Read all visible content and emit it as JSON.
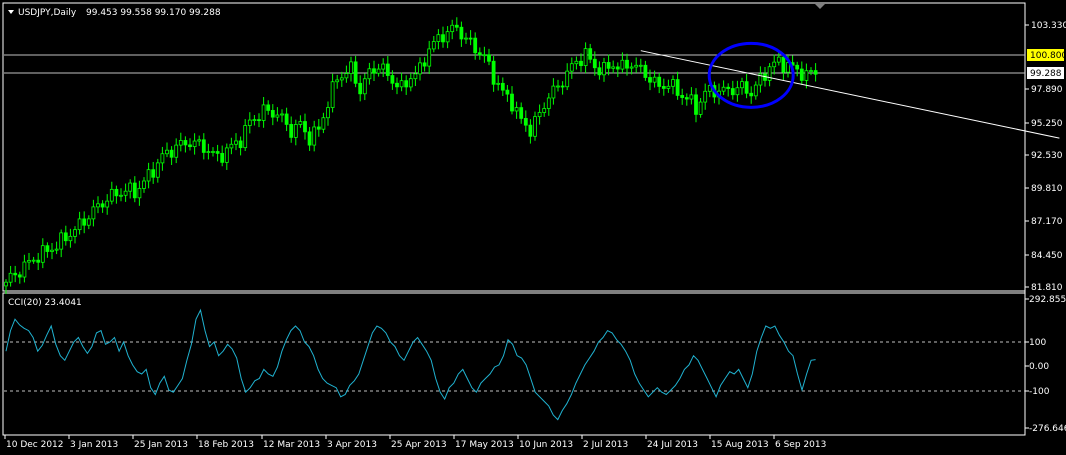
{
  "main_panel": {
    "title": "USDJPY,Daily",
    "ohlc": "99.453 99.558 99.170 99.288",
    "menu_arrow": "triangle-down-icon"
  },
  "indicator_panel": {
    "title": "CCI(20) 23.4041"
  },
  "colors": {
    "background": "#000000",
    "candles": "#00ff00",
    "grid_border": "#ffffff",
    "h_lines": "#c0c0c0",
    "highlight_label": "#ffff00",
    "current_label": "#ffffff",
    "cci_line": "#20b2d0",
    "annotation_ellipse": "#0000ff",
    "trendline": "#ffffff"
  },
  "chart_data": [
    {
      "type": "candlestick",
      "title": "USDJPY,Daily",
      "ylim": [
        81.81,
        104.5
      ],
      "y_ticks": [
        "103.330",
        "100.800",
        "99.288",
        "97.890",
        "95.250",
        "92.530",
        "89.810",
        "87.170",
        "84.450",
        "81.810"
      ],
      "horizontal_lines": [
        100.8,
        99.288
      ],
      "highlighted_price": "100.800",
      "current_price": "99.288",
      "x_ticks": [
        "10 Dec 2012",
        "3 Jan 2013",
        "25 Jan 2013",
        "18 Feb 2013",
        "12 Mar 2013",
        "3 Apr 2013",
        "25 Apr 2013",
        "17 May 2013",
        "10 Jun 2013",
        "2 Jul 2013",
        "24 Jul 2013",
        "15 Aug 2013",
        "6 Sep 2013"
      ],
      "close_path": [
        [
          0,
          82.2
        ],
        [
          6,
          84.1
        ],
        [
          11,
          85.2
        ],
        [
          16,
          86.8
        ],
        [
          19,
          88.0
        ],
        [
          22,
          89.0
        ],
        [
          26,
          89.7
        ],
        [
          28,
          89.5
        ],
        [
          31,
          90.8
        ],
        [
          34,
          92.4
        ],
        [
          37,
          93.2
        ],
        [
          40,
          93.6
        ],
        [
          43,
          93.2
        ],
        [
          46,
          92.3
        ],
        [
          48,
          92.9
        ],
        [
          51,
          93.8
        ],
        [
          53,
          95.2
        ],
        [
          56,
          96.1
        ],
        [
          59,
          95.9
        ],
        [
          62,
          94.5
        ],
        [
          64,
          95.0
        ],
        [
          66,
          93.9
        ],
        [
          68,
          94.6
        ],
        [
          70,
          96.8
        ],
        [
          72,
          98.8
        ],
        [
          75,
          99.5
        ],
        [
          77,
          97.8
        ],
        [
          79,
          99.2
        ],
        [
          81,
          99.8
        ],
        [
          83,
          99.0
        ],
        [
          86,
          97.9
        ],
        [
          88,
          98.9
        ],
        [
          90,
          99.4
        ],
        [
          92,
          101.2
        ],
        [
          95,
          102.3
        ],
        [
          98,
          102.9
        ],
        [
          100,
          101.9
        ],
        [
          102,
          101.2
        ],
        [
          104,
          100.5
        ],
        [
          106,
          98.9
        ],
        [
          108,
          97.6
        ],
        [
          110,
          96.8
        ],
        [
          112,
          95.3
        ],
        [
          114,
          94.6
        ],
        [
          116,
          95.8
        ],
        [
          118,
          97.4
        ],
        [
          120,
          98.0
        ],
        [
          122,
          99.2
        ],
        [
          124,
          100.1
        ],
        [
          126,
          100.7
        ],
        [
          128,
          99.7
        ],
        [
          130,
          99.4
        ],
        [
          132,
          99.9
        ],
        [
          134,
          99.6
        ],
        [
          136,
          100.0
        ],
        [
          138,
          99.4
        ],
        [
          140,
          98.8
        ],
        [
          142,
          98.0
        ],
        [
          144,
          98.4
        ],
        [
          146,
          97.6
        ],
        [
          148,
          97.2
        ],
        [
          150,
          96.3
        ],
        [
          152,
          97.6
        ],
        [
          154,
          97.8
        ],
        [
          156,
          97.7
        ],
        [
          158,
          97.9
        ],
        [
          160,
          98.0
        ],
        [
          162,
          97.6
        ],
        [
          164,
          98.6
        ],
        [
          166,
          99.7
        ],
        [
          168,
          100.1
        ],
        [
          170,
          99.8
        ],
        [
          172,
          99.4
        ],
        [
          174,
          99.0
        ],
        [
          176,
          99.3
        ]
      ],
      "trendline": {
        "from": [
          138,
          101.0
        ],
        "to": [
          229,
          93.9
        ]
      },
      "annotation": {
        "type": "ellipse",
        "center": [
          162,
          99.0
        ]
      }
    },
    {
      "type": "line",
      "title": "CCI(20) 23.4041",
      "ylim": [
        -276.646,
        292.8552
      ],
      "y_ticks": [
        "292.8552",
        "100",
        "0.00",
        "-100",
        "-276.646"
      ],
      "levels": [
        100,
        -100
      ],
      "values": [
        60,
        150,
        200,
        175,
        160,
        150,
        120,
        60,
        85,
        130,
        170,
        90,
        40,
        20,
        60,
        100,
        120,
        80,
        50,
        80,
        140,
        150,
        90,
        100,
        120,
        60,
        100,
        40,
        0,
        -30,
        -40,
        -20,
        -100,
        -130,
        -80,
        -50,
        -110,
        -120,
        -90,
        -60,
        20,
        90,
        200,
        240,
        150,
        80,
        100,
        40,
        60,
        90,
        70,
        30,
        -60,
        -120,
        -100,
        -70,
        -60,
        -20,
        -40,
        -50,
        -10,
        60,
        110,
        150,
        170,
        150,
        100,
        80,
        40,
        -20,
        -60,
        -80,
        -90,
        -100,
        -140,
        -130,
        -90,
        -70,
        -40,
        20,
        80,
        140,
        170,
        160,
        140,
        100,
        80,
        40,
        20,
        60,
        100,
        120,
        90,
        60,
        20,
        -60,
        -120,
        -150,
        -100,
        -80,
        -40,
        -20,
        -60,
        -100,
        -120,
        -80,
        -60,
        -40,
        -10,
        0,
        40,
        110,
        90,
        40,
        30,
        0,
        -60,
        -120,
        -140,
        -160,
        -180,
        -220,
        -240,
        -200,
        -170,
        -130,
        -80,
        -40,
        0,
        30,
        60,
        100,
        120,
        150,
        140,
        110,
        90,
        60,
        20,
        -40,
        -80,
        -110,
        -140,
        -120,
        -100,
        -120,
        -130,
        -110,
        -90,
        -60,
        -20,
        0,
        40,
        20,
        -20,
        -60,
        -100,
        -140,
        -90,
        -60,
        -30,
        -40,
        -20,
        -60,
        -100,
        -40,
        60,
        120,
        170,
        160,
        170,
        130,
        100,
        60,
        40,
        -40,
        -110,
        -40,
        20,
        23
      ]
    }
  ]
}
